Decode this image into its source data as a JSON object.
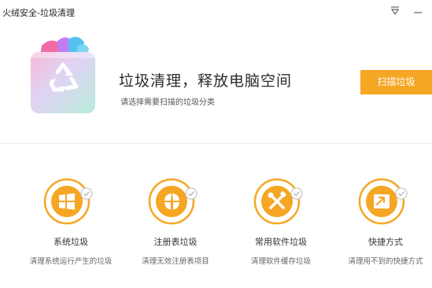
{
  "window": {
    "title": "火绒安全-垃圾清理"
  },
  "hero": {
    "title": "垃圾清理，释放电脑空间",
    "subtitle": "请选择需要扫描的垃圾分类",
    "scan_button": "扫描垃圾",
    "icon": "recycle-bin-icon"
  },
  "categories": [
    {
      "name": "系统垃圾",
      "desc": "清理系统运行产生的垃圾",
      "icon": "windows-icon",
      "checked": true
    },
    {
      "name": "注册表垃圾",
      "desc": "清理无效注册表项目",
      "icon": "registry-icon",
      "checked": true
    },
    {
      "name": "常用软件垃圾",
      "desc": "清理软件缓存垃圾",
      "icon": "tools-icon",
      "checked": true
    },
    {
      "name": "快捷方式",
      "desc": "清理用不到的快捷方式",
      "icon": "shortcut-icon",
      "checked": true
    }
  ],
  "colors": {
    "accent": "#f5a623",
    "accent_dark": "#e8891b",
    "check": "#bdbdbd"
  }
}
